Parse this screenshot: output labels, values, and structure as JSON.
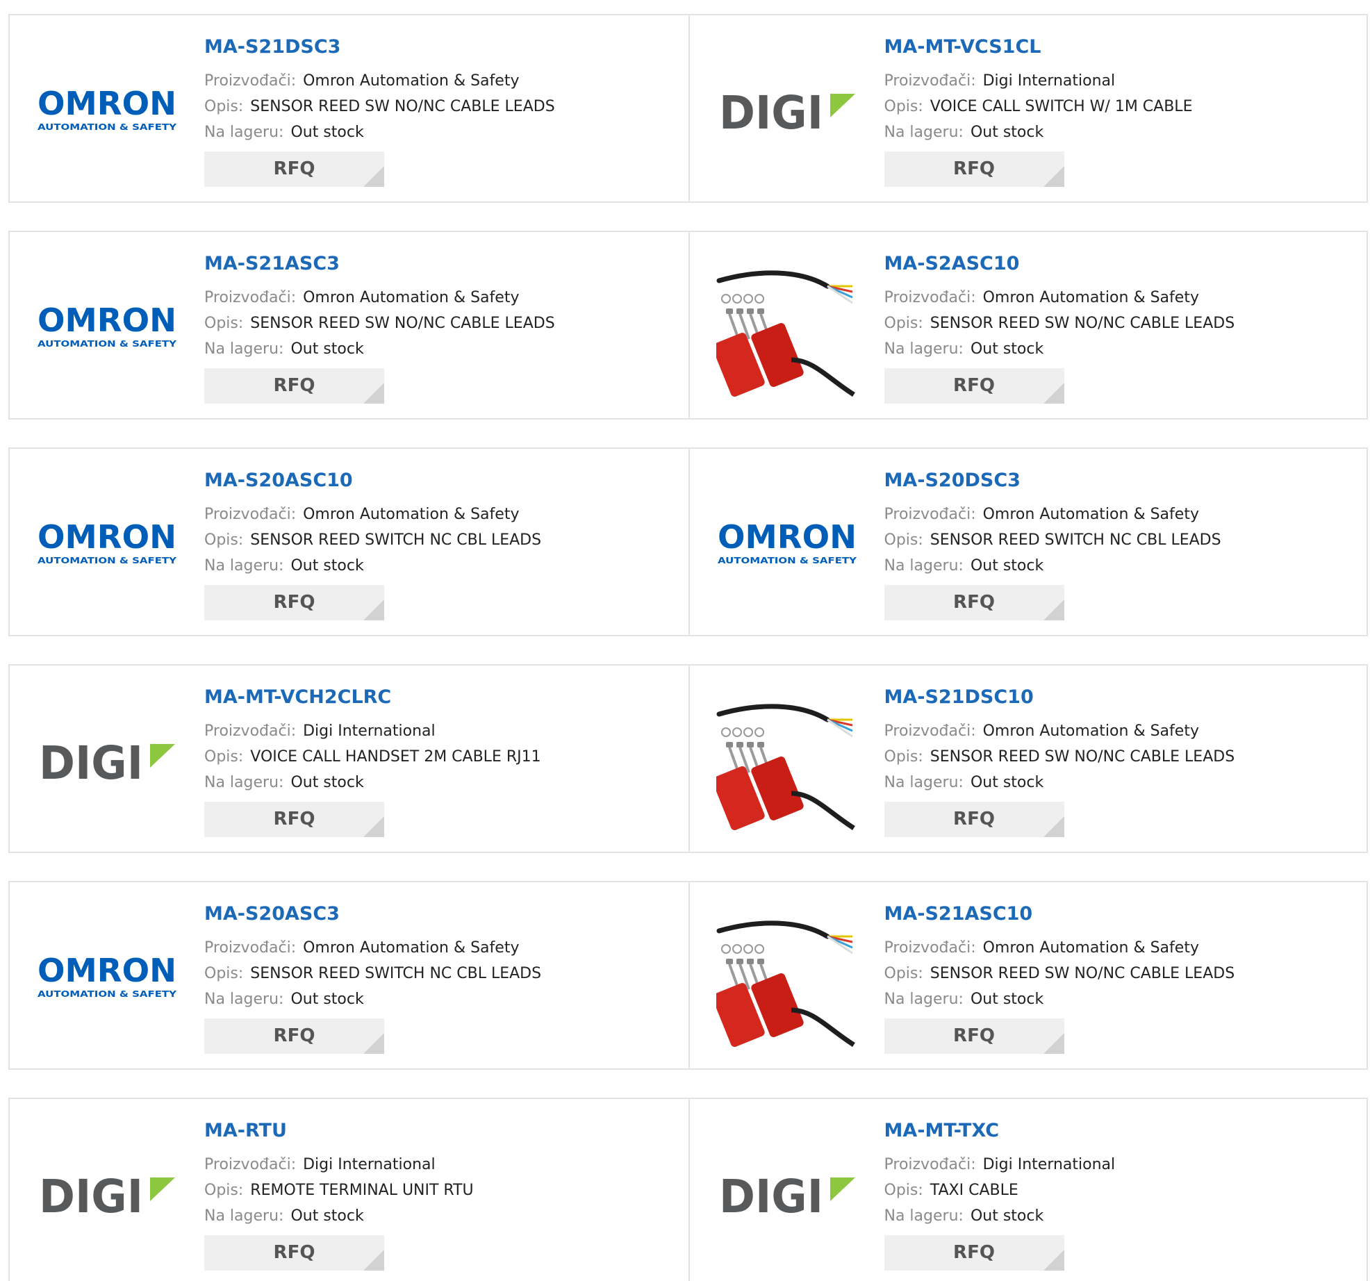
{
  "labels": {
    "manufacturer": "Proizvođači:",
    "description": "Opis:",
    "stock": "Na lageru:",
    "rfq": "RFQ"
  },
  "logos": {
    "omron": {
      "name": "OMRON",
      "tagline": "AUTOMATION & SAFETY",
      "color": "#005eb8"
    },
    "digi": {
      "name": "DIGI",
      "color": "#58595b",
      "accent": "#8dc63f"
    }
  },
  "products": [
    {
      "part": "MA-S21DSC3",
      "manufacturer": "Omron Automation & Safety",
      "description": "SENSOR REED SW NO/NC CABLE LEADS",
      "stock": "Out stock",
      "image": "omron-logo"
    },
    {
      "part": "MA-MT-VCS1CL",
      "manufacturer": "Digi International",
      "description": "VOICE CALL SWITCH W/ 1M CABLE",
      "stock": "Out stock",
      "image": "digi-logo"
    },
    {
      "part": "MA-S21ASC3",
      "manufacturer": "Omron Automation & Safety",
      "description": "SENSOR REED SW NO/NC CABLE LEADS",
      "stock": "Out stock",
      "image": "omron-logo"
    },
    {
      "part": "MA-S2ASC10",
      "manufacturer": "Omron Automation & Safety",
      "description": "SENSOR REED SW NO/NC CABLE LEADS",
      "stock": "Out stock",
      "image": "sensor-photo"
    },
    {
      "part": "MA-S20ASC10",
      "manufacturer": "Omron Automation & Safety",
      "description": "SENSOR REED SWITCH NC CBL LEADS",
      "stock": "Out stock",
      "image": "omron-logo"
    },
    {
      "part": "MA-S20DSC3",
      "manufacturer": "Omron Automation & Safety",
      "description": "SENSOR REED SWITCH NC CBL LEADS",
      "stock": "Out stock",
      "image": "omron-logo"
    },
    {
      "part": "MA-MT-VCH2CLRC",
      "manufacturer": "Digi International",
      "description": "VOICE CALL HANDSET 2M CABLE RJ11",
      "stock": "Out stock",
      "image": "digi-logo"
    },
    {
      "part": "MA-S21DSC10",
      "manufacturer": "Omron Automation & Safety",
      "description": "SENSOR REED SW NO/NC CABLE LEADS",
      "stock": "Out stock",
      "image": "sensor-photo"
    },
    {
      "part": "MA-S20ASC3",
      "manufacturer": "Omron Automation & Safety",
      "description": "SENSOR REED SWITCH NC CBL LEADS",
      "stock": "Out stock",
      "image": "omron-logo"
    },
    {
      "part": "MA-S21ASC10",
      "manufacturer": "Omron Automation & Safety",
      "description": "SENSOR REED SW NO/NC CABLE LEADS",
      "stock": "Out stock",
      "image": "sensor-photo"
    },
    {
      "part": "MA-RTU",
      "manufacturer": "Digi International",
      "description": "REMOTE TERMINAL UNIT RTU",
      "stock": "Out stock",
      "image": "digi-logo"
    },
    {
      "part": "MA-MT-TXC",
      "manufacturer": "Digi International",
      "description": "TAXI CABLE",
      "stock": "Out stock",
      "image": "digi-logo"
    }
  ]
}
